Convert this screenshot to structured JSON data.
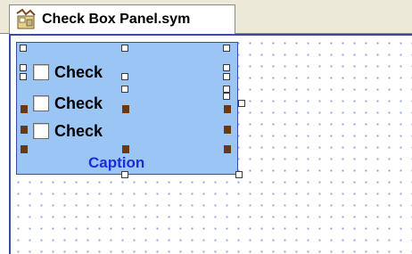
{
  "tab": {
    "title": "Check Box Panel.sym"
  },
  "checkboxes": [
    {
      "label": "Check",
      "checked": false
    },
    {
      "label": "Check",
      "checked": false
    },
    {
      "label": "Check",
      "checked": false
    }
  ],
  "panel": {
    "caption": "Caption",
    "background": "#9bc5f5",
    "caption_color": "#1f2bd8"
  },
  "icons": {
    "tab_icon": "symbol-file-icon"
  }
}
